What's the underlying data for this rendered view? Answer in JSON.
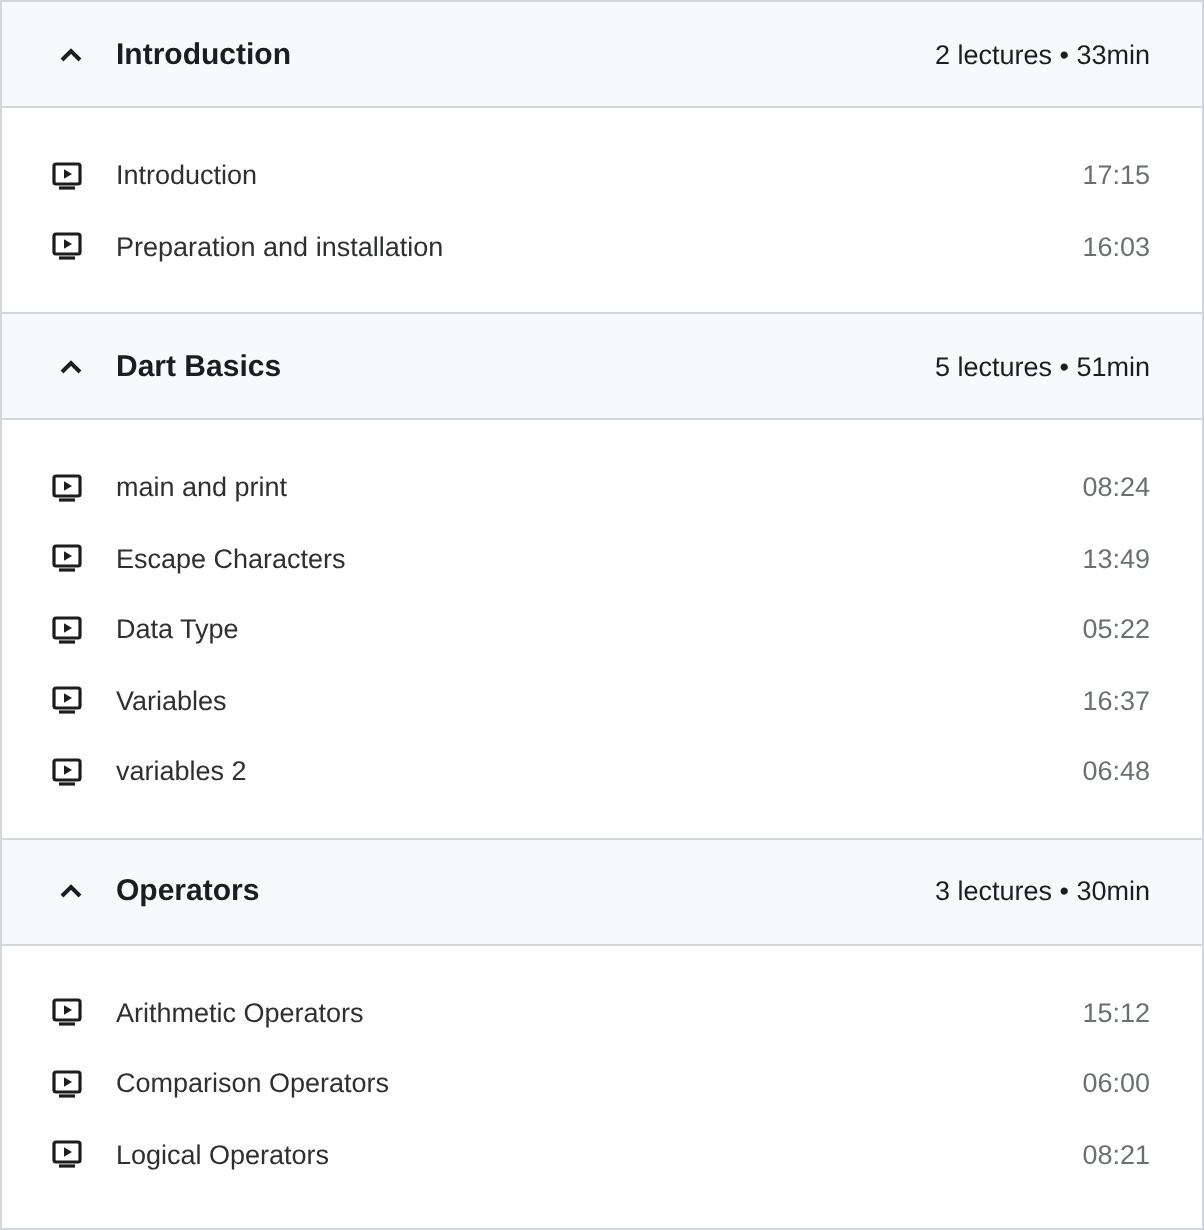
{
  "sections": [
    {
      "title": "Introduction",
      "expanded": true,
      "summary": "2 lectures • 33min",
      "lectures": [
        {
          "title": "Introduction",
          "duration": "17:15"
        },
        {
          "title": "Preparation and installation",
          "duration": "16:03"
        }
      ]
    },
    {
      "title": "Dart Basics",
      "expanded": true,
      "summary": "5 lectures • 51min",
      "lectures": [
        {
          "title": "main and print",
          "duration": "08:24"
        },
        {
          "title": "Escape Characters",
          "duration": "13:49"
        },
        {
          "title": "Data Type",
          "duration": "05:22"
        },
        {
          "title": "Variables",
          "duration": "16:37"
        },
        {
          "title": "variables 2",
          "duration": "06:48"
        }
      ]
    },
    {
      "title": "Operators",
      "expanded": true,
      "summary": "3 lectures • 30min",
      "lectures": [
        {
          "title": "Arithmetic Operators",
          "duration": "15:12"
        },
        {
          "title": "Comparison Operators",
          "duration": "06:00"
        },
        {
          "title": "Logical Operators",
          "duration": "08:21"
        }
      ]
    }
  ]
}
